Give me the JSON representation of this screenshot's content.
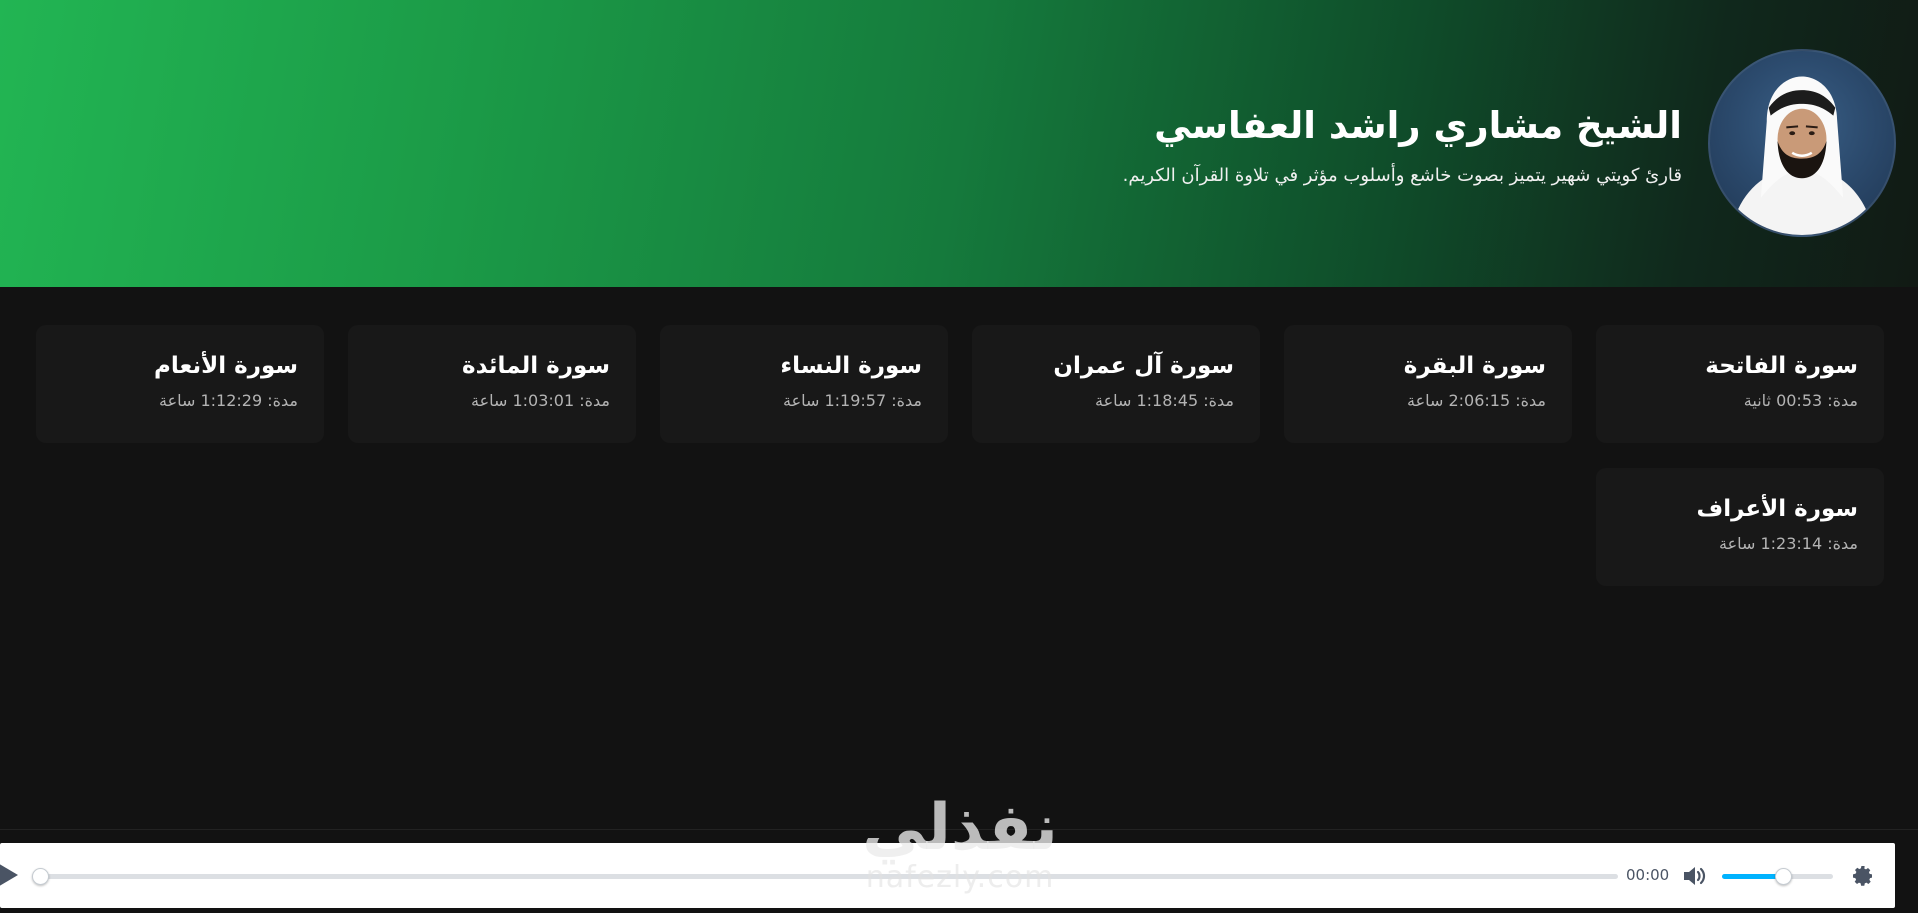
{
  "reciter": {
    "name": "الشيخ مشاري راشد العفاسي",
    "bio": "قارئ كويتي شهير يتميز بصوت خاشع وأسلوب مؤثر في تلاوة القرآن الكريم."
  },
  "surahs": [
    {
      "title": "سورة الفاتحة",
      "duration": "مدة: 00:53 ثانية"
    },
    {
      "title": "سورة البقرة",
      "duration": "مدة: 2:06:15 ساعة"
    },
    {
      "title": "سورة آل عمران",
      "duration": "مدة: 1:18:45 ساعة"
    },
    {
      "title": "سورة النساء",
      "duration": "مدة: 1:19:57 ساعة"
    },
    {
      "title": "سورة المائدة",
      "duration": "مدة: 1:03:01 ساعة"
    },
    {
      "title": "سورة الأنعام",
      "duration": "مدة: 1:12:29 ساعة"
    },
    {
      "title": "سورة الأعراف",
      "duration": "مدة: 1:23:14 ساعة"
    }
  ],
  "player": {
    "current_time": "00:00",
    "progress_fraction": 0,
    "volume_fraction": 0.55,
    "icons": {
      "play": "play-icon",
      "volume": "volume-icon",
      "settings": "gear-icon"
    }
  },
  "watermark": {
    "logo_text": "نفذلي",
    "url": "nafezly.com"
  },
  "colors": {
    "hero_start": "#22b553",
    "hero_end": "#111a14",
    "background": "#121212",
    "card": "#181818",
    "accent": "#00b3ff"
  }
}
